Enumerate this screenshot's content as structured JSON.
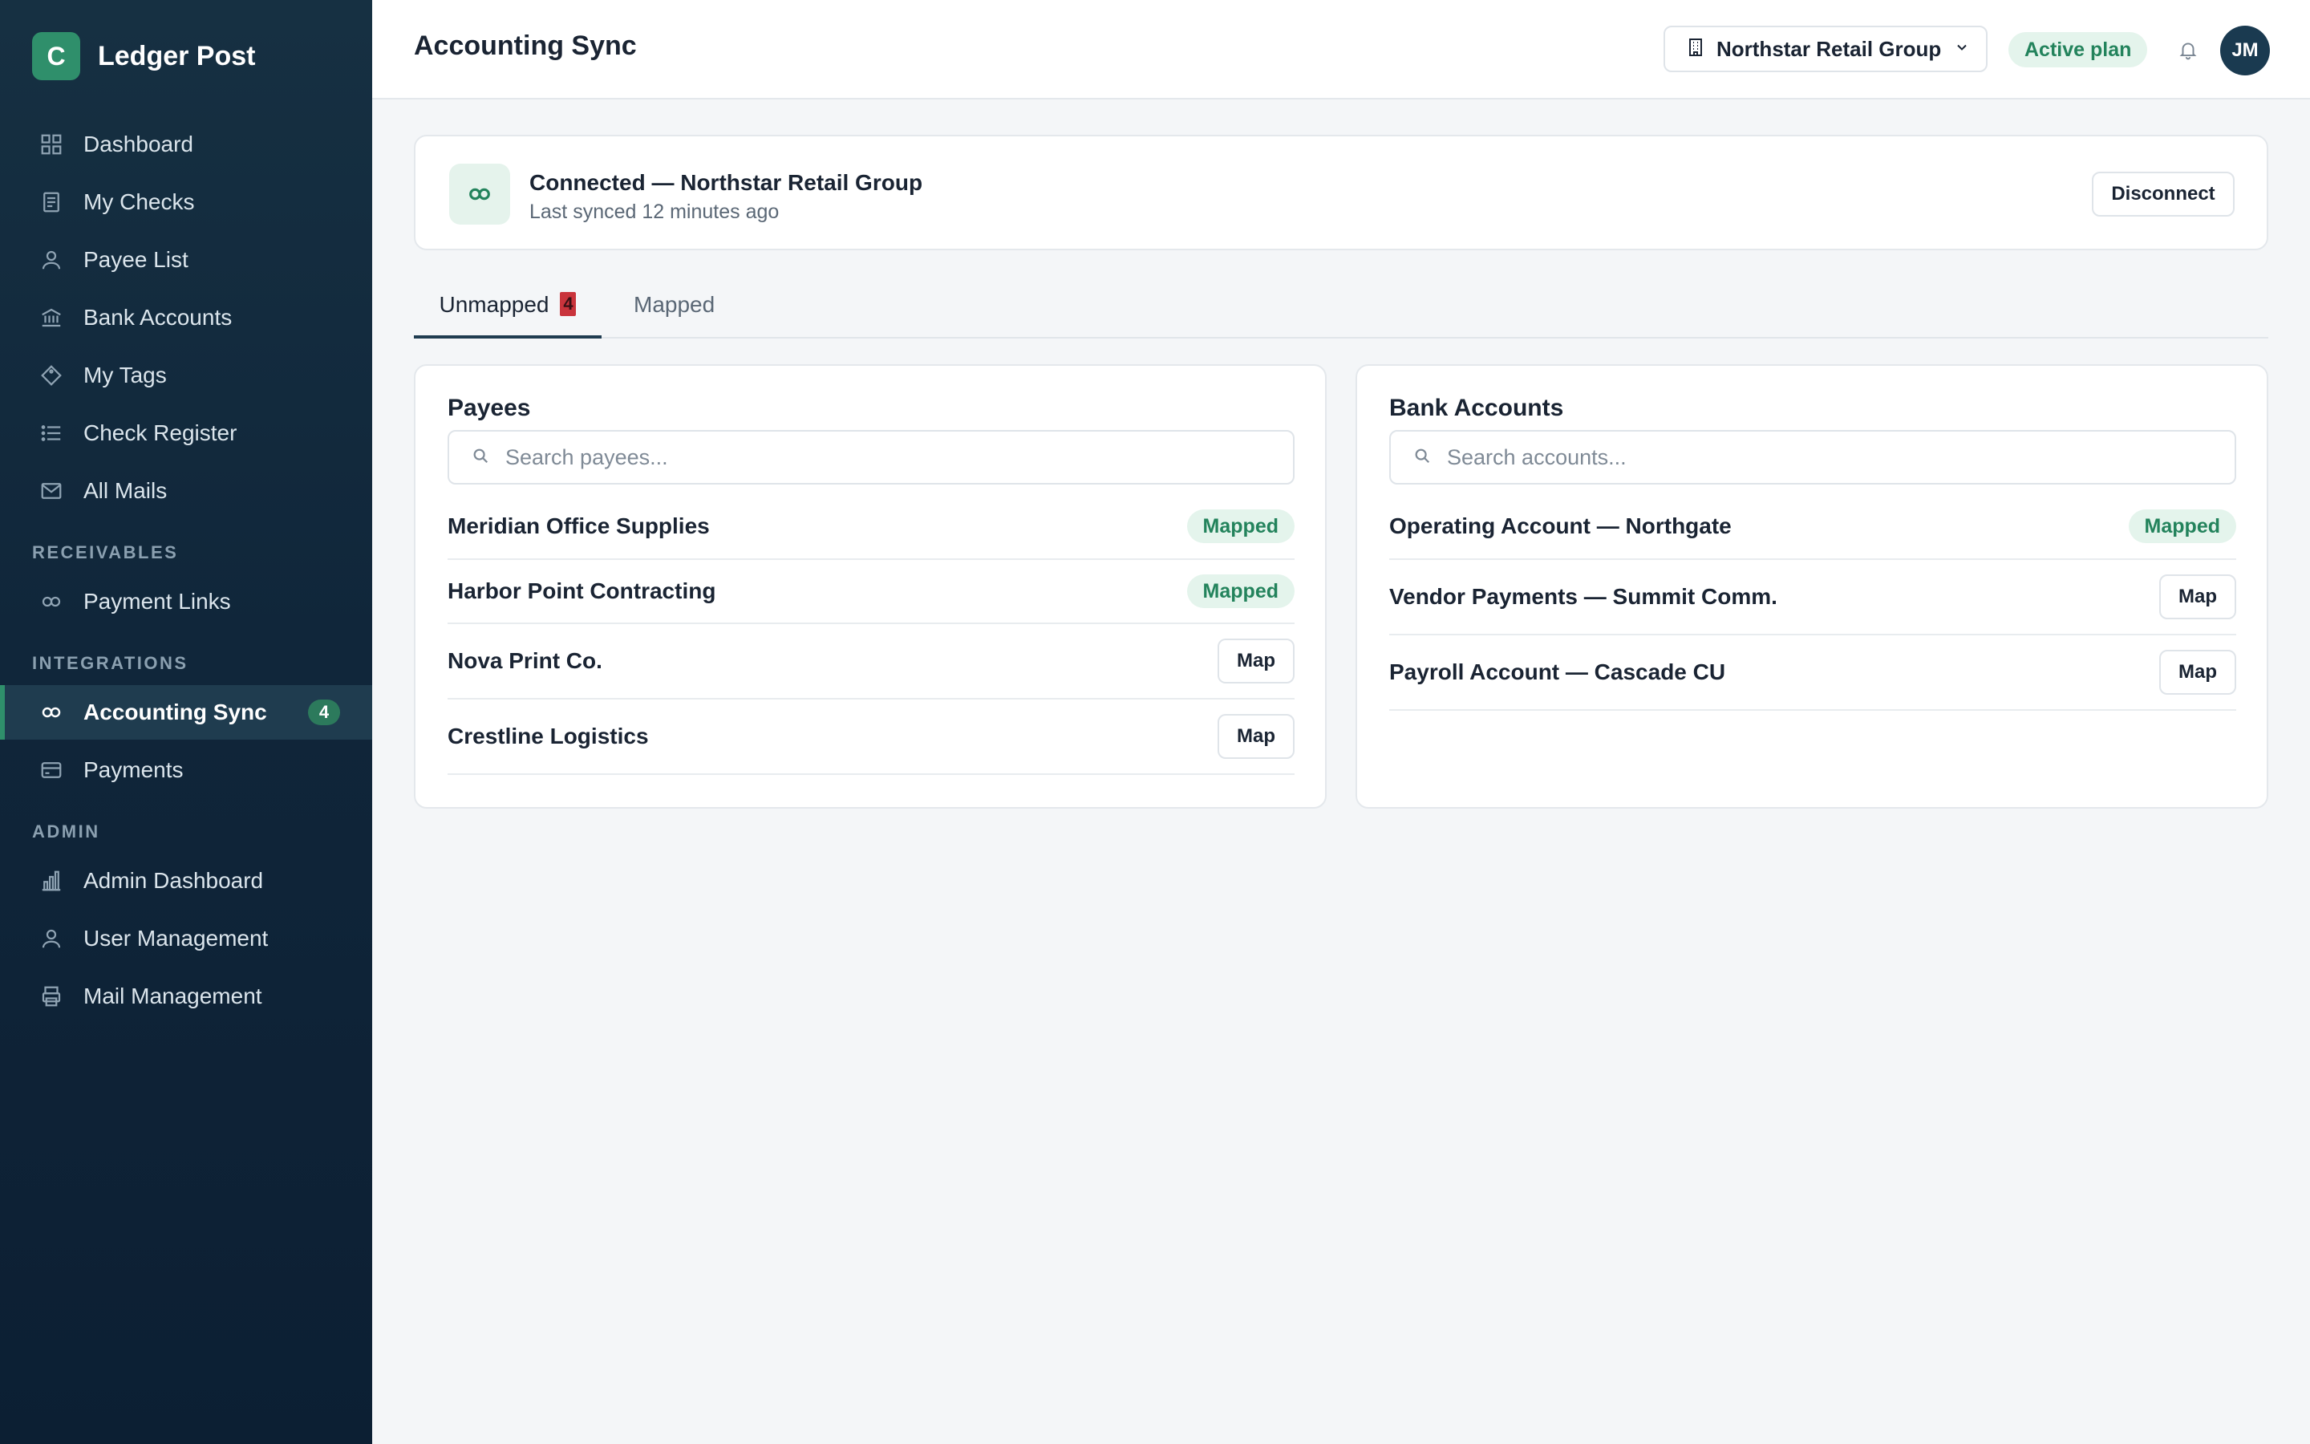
{
  "brand": {
    "initial": "C",
    "name": "Ledger Post"
  },
  "sidebar": {
    "items": [
      {
        "label": "Dashboard",
        "icon": "grid-icon"
      },
      {
        "label": "My Checks",
        "icon": "document-icon"
      },
      {
        "label": "Payee List",
        "icon": "user-icon"
      },
      {
        "label": "Bank Accounts",
        "icon": "bank-icon"
      },
      {
        "label": "My Tags",
        "icon": "tag-icon"
      },
      {
        "label": "Check Register",
        "icon": "list-icon"
      },
      {
        "label": "All Mails",
        "icon": "mail-icon"
      }
    ],
    "sections": {
      "receivables": "RECEIVABLES",
      "integrations": "INTEGRATIONS",
      "admin": "ADMIN"
    },
    "receivables_items": [
      {
        "label": "Payment Links",
        "icon": "link-icon"
      }
    ],
    "integrations_items": [
      {
        "label": "Accounting Sync",
        "icon": "link-icon",
        "badge": "4",
        "active": true
      },
      {
        "label": "Payments",
        "icon": "card-icon"
      }
    ],
    "admin_items": [
      {
        "label": "Admin Dashboard",
        "icon": "bar-chart-icon"
      },
      {
        "label": "User Management",
        "icon": "user-icon"
      },
      {
        "label": "Mail Management",
        "icon": "printer-icon"
      }
    ]
  },
  "header": {
    "title": "Accounting Sync",
    "org_select": "Northstar Retail Group",
    "plan_badge": "Active plan",
    "avatar_initials": "JM"
  },
  "connection": {
    "title": "Connected — Northstar Retail Group",
    "subtitle": "Last synced 12 minutes ago",
    "disconnect_label": "Disconnect"
  },
  "tabs": {
    "unmapped_label": "Unmapped",
    "unmapped_count": "4",
    "mapped_label": "Mapped"
  },
  "payees": {
    "title": "Payees",
    "search_placeholder": "Search payees...",
    "rows": [
      {
        "name": "Meridian Office Supplies",
        "status": "Mapped"
      },
      {
        "name": "Harbor Point Contracting",
        "status": "Mapped"
      },
      {
        "name": "Nova Print Co.",
        "action": "Map"
      },
      {
        "name": "Crestline Logistics",
        "action": "Map"
      }
    ]
  },
  "accounts": {
    "title": "Bank Accounts",
    "search_placeholder": "Search accounts...",
    "rows": [
      {
        "name": "Operating Account — Northgate",
        "status": "Mapped"
      },
      {
        "name": "Vendor Payments — Summit Comm.",
        "action": "Map"
      },
      {
        "name": "Payroll Account — Cascade CU",
        "action": "Map"
      }
    ]
  },
  "colors": {
    "sidebar_bg": "#10263a",
    "accent": "#2f8f6b",
    "mapped_bg": "#e4f4ec",
    "mapped_text": "#23835c",
    "tab_count_bg": "#c9343c"
  }
}
